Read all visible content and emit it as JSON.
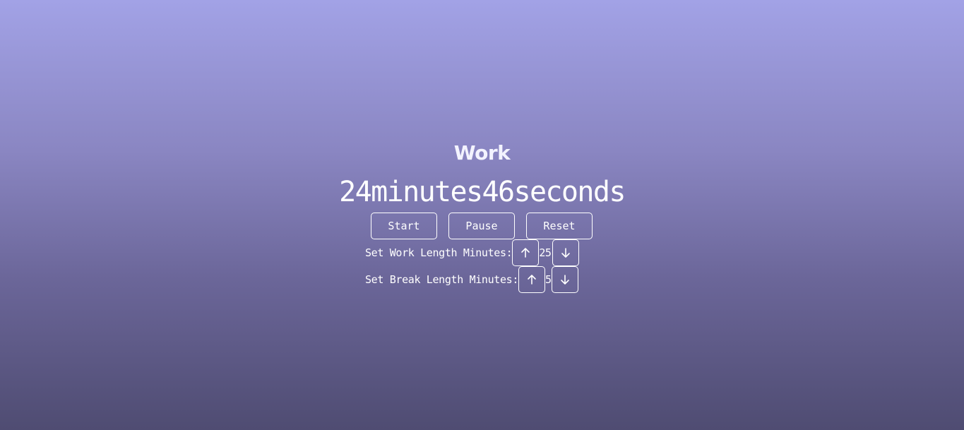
{
  "mode": {
    "title": "Work"
  },
  "timer": {
    "display": "24minutes46seconds",
    "minutes": 24,
    "seconds": 46
  },
  "controls": {
    "start_label": "Start",
    "pause_label": "Pause",
    "reset_label": "Reset"
  },
  "settings": {
    "work": {
      "label": "Set Work Length Minutes:",
      "value": "25",
      "increment_icon": "arrow-up-icon",
      "decrement_icon": "arrow-down-icon"
    },
    "break": {
      "label": "Set Break Length Minutes:",
      "value": "5",
      "increment_icon": "arrow-up-icon",
      "decrement_icon": "arrow-down-icon"
    }
  },
  "colors": {
    "gradient_top": "#a2a2e6",
    "gradient_bottom": "#4f4c72",
    "text": "#ffffff"
  }
}
